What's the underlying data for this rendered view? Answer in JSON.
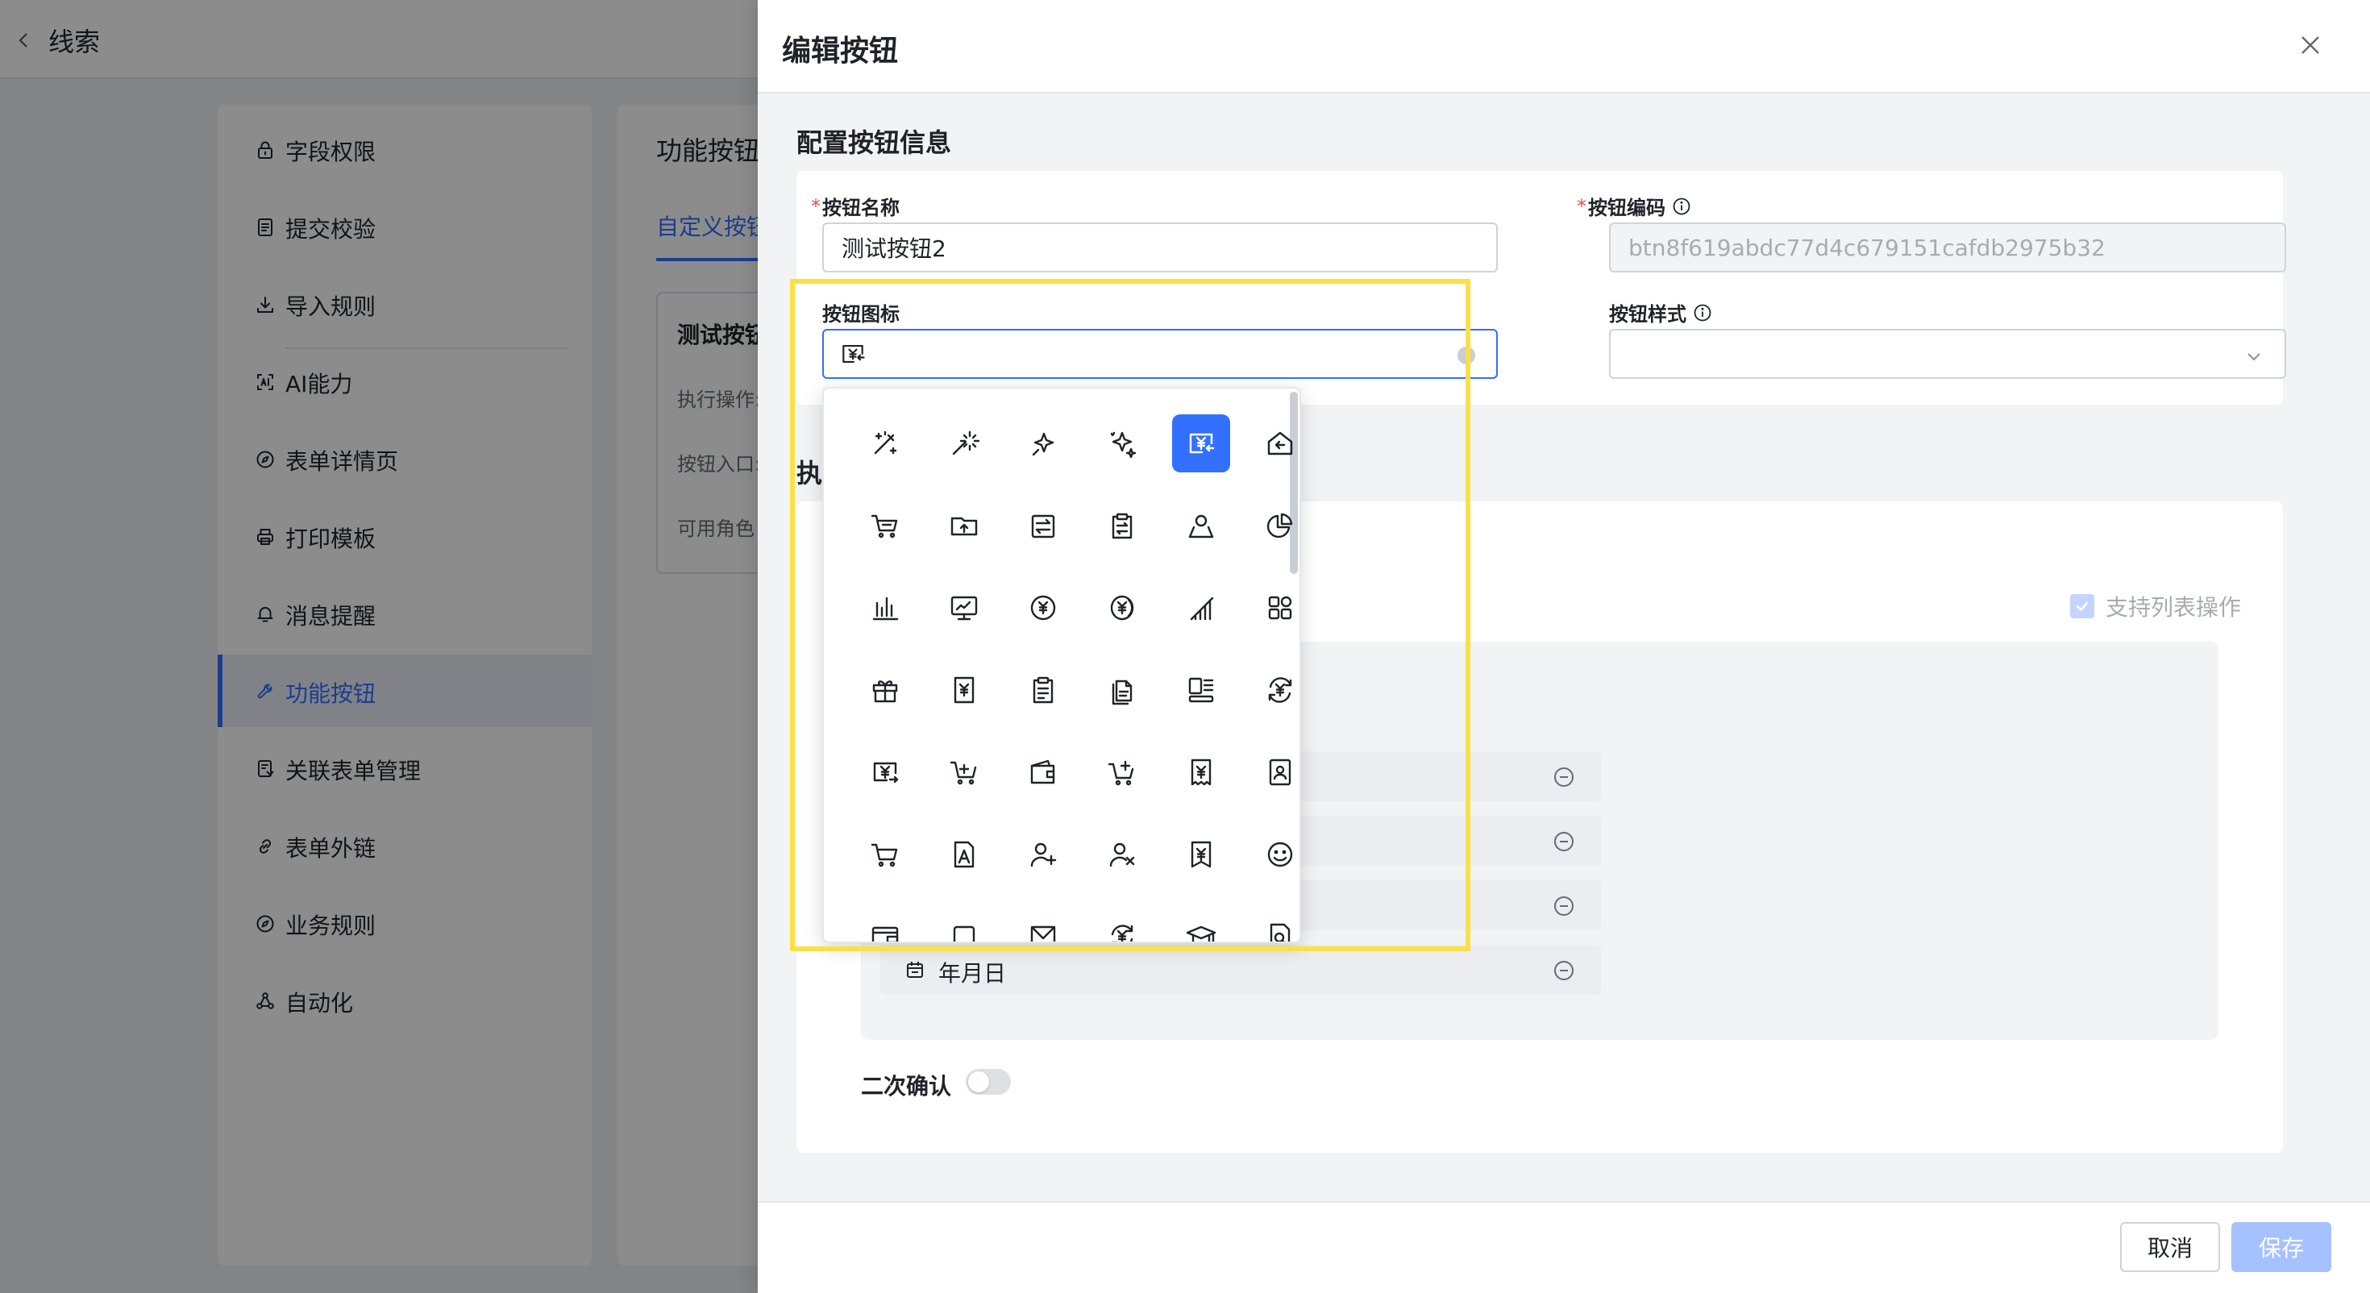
{
  "background": {
    "back_label": "线索",
    "nav_items": [
      {
        "label": "字段权限",
        "icon": "lock-icon"
      },
      {
        "label": "提交校验",
        "icon": "checklist-icon"
      },
      {
        "label": "导入规则",
        "icon": "download-icon"
      },
      {
        "label": "AI能力",
        "icon": "ai-icon"
      },
      {
        "label": "表单详情页",
        "icon": "compass-icon"
      },
      {
        "label": "打印模板",
        "icon": "printer-icon"
      },
      {
        "label": "消息提醒",
        "icon": "bell-icon"
      },
      {
        "label": "功能按钮",
        "icon": "wrench-icon"
      },
      {
        "label": "关联表单管理",
        "icon": "form-link-icon"
      },
      {
        "label": "表单外链",
        "icon": "link-icon"
      },
      {
        "label": "业务规则",
        "icon": "compass-icon"
      },
      {
        "label": "自动化",
        "icon": "flow-icon"
      }
    ],
    "active_nav": "功能按钮",
    "main_title": "功能按钮",
    "main_tab": "自定义按钮",
    "button_card": {
      "title": "测试按钮",
      "lines": [
        "执行操作:",
        "按钮入口:",
        "可用角色"
      ]
    }
  },
  "drawer": {
    "title": "编辑按钮",
    "config_section": {
      "title": "配置按钮信息",
      "name": {
        "label": "按钮名称",
        "required": "*",
        "value": "测试按钮2"
      },
      "code": {
        "label": "按钮编码",
        "required": "*",
        "value": "btn8f619abdc77d4c679151cafdb2975b32"
      },
      "icon": {
        "label": "按钮图标",
        "value_icon": "yen-screen-enter-icon"
      },
      "style": {
        "label": "按钮样式",
        "value": ""
      }
    },
    "exec_section": {
      "title": "执",
      "required": "*",
      "list_op_label": "支持列表操作",
      "list_op_checked": true,
      "visible_field": "年月日",
      "confirm_label": "二次确认",
      "confirm_on": false
    },
    "footer": {
      "cancel": "取消",
      "save": "保存"
    }
  },
  "icon_picker": {
    "selected": "yen-screen-enter-icon",
    "rows": [
      [
        "magic-wand-icon",
        "sparkle-wand-icon",
        "sparkle-icon",
        "sparkles-icon",
        "yen-screen-enter-icon",
        "home-back-icon"
      ],
      [
        "shopping-cart-icon",
        "folder-upload-icon",
        "transfer-doc-icon",
        "clipboard-transfer-icon",
        "user-profile-icon",
        "pie-chart-icon"
      ],
      [
        "bar-chart-icon",
        "monitor-chart-icon",
        "yen-circle-icon",
        "yen-coin-icon",
        "signal-bars-icon",
        "grid-apps-icon"
      ],
      [
        "gift-icon",
        "yen-doc-icon",
        "clipboard-list-icon",
        "doc-copy-icon",
        "dashboard-layout-icon",
        "yen-exchange-icon"
      ],
      [
        "yen-screen-icon",
        "cart-plus-icon",
        "wallet-icon",
        "cart-add-icon",
        "yen-receipt-icon",
        "contact-card-icon"
      ],
      [
        "cart-icon",
        "user-doc-icon",
        "user-add-icon",
        "user-remove-icon",
        "yen-ticket-icon",
        "smile-icon"
      ],
      [
        "wallet-card-icon",
        "bell-icon",
        "mail-box-icon",
        "yen-refresh-icon",
        "graduation-cap-icon",
        "doc-search-icon"
      ]
    ]
  },
  "colors": {
    "accent": "#3370ff",
    "highlight": "#fbe044",
    "required": "#f54a45"
  }
}
